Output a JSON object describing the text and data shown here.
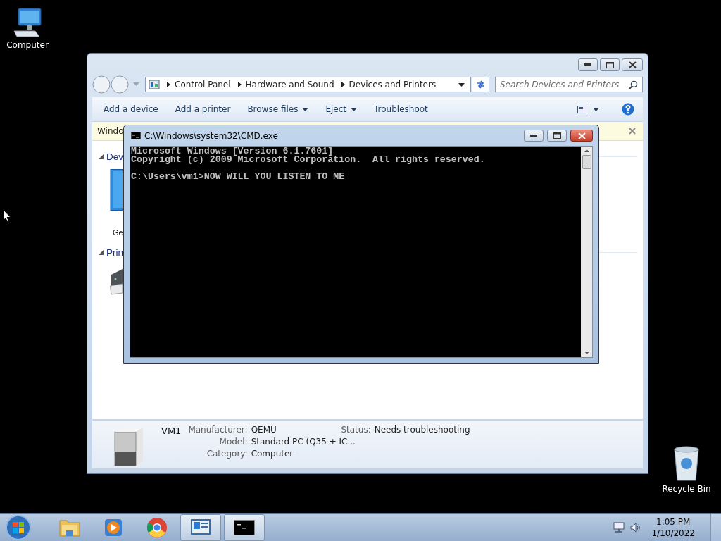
{
  "desktop_icons": [
    {
      "label": "Computer",
      "kind": "computer"
    },
    {
      "label": "Recycle Bin",
      "kind": "recycle"
    }
  ],
  "explorer": {
    "breadcrumb": [
      "Control Panel",
      "Hardware and Sound",
      "Devices and Printers"
    ],
    "search": {
      "placeholder": "Search Devices and Printers"
    },
    "commands": [
      {
        "label": "Add a device",
        "dropdown": false
      },
      {
        "label": "Add a printer",
        "dropdown": false
      },
      {
        "label": "Browse files",
        "dropdown": true
      },
      {
        "label": "Eject",
        "dropdown": true
      },
      {
        "label": "Troubleshoot",
        "dropdown": false
      }
    ],
    "infobar": "Windo",
    "groups": [
      {
        "title": "Dev",
        "devices": [
          {
            "label": "Ge",
            "kind": "monitor"
          }
        ]
      },
      {
        "title": "Prin",
        "devices": [
          {
            "kind": "printer"
          }
        ]
      }
    ],
    "details": {
      "name": "VM1",
      "fields": [
        {
          "label": "Manufacturer:",
          "value": "QEMU"
        },
        {
          "label": "Model:",
          "value": "Standard PC (Q35 + IC..."
        },
        {
          "label": "Category:",
          "value": "Computer"
        }
      ],
      "status": {
        "label": "Status:",
        "value": "Needs troubleshooting"
      }
    }
  },
  "console": {
    "title": "C:\\Windows\\system32\\CMD.exe",
    "lines": [
      {
        "text": "Microsoft Windows [Version 6.1.7601]"
      },
      {
        "text": "Copyright (c) 2009 Microsoft Corporation.  All rights reserved."
      },
      {
        "text": "C:\\Users\\vm1>NOW WILL YOU LISTEN TO ME",
        "gap_before": true
      }
    ]
  },
  "taskbar": {
    "apps": [
      {
        "kind": "folder",
        "selected": false
      },
      {
        "kind": "media",
        "selected": false
      },
      {
        "kind": "browser",
        "selected": false
      },
      {
        "kind": "devices",
        "selected": true
      },
      {
        "kind": "terminal",
        "selected": true
      }
    ],
    "time": "1:05 PM",
    "date": "1/10/2022"
  }
}
